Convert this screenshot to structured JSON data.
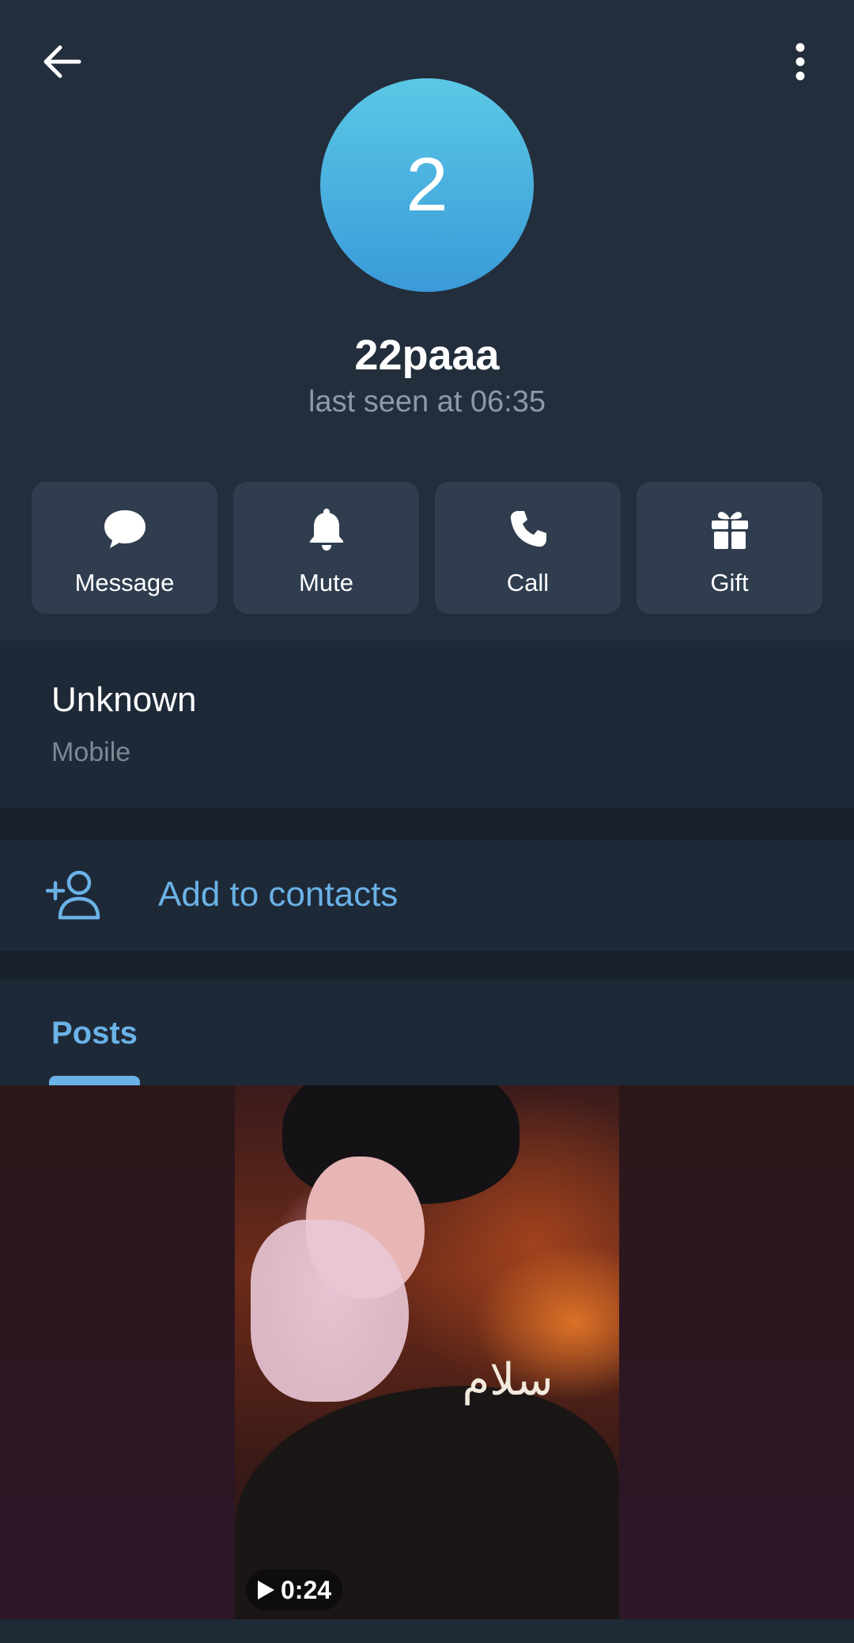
{
  "header": {
    "avatar_letter": "2",
    "name": "22paaa",
    "status": "last seen at 06:35"
  },
  "actions": [
    {
      "label": "Message",
      "icon": "message-icon"
    },
    {
      "label": "Mute",
      "icon": "bell-icon"
    },
    {
      "label": "Call",
      "icon": "phone-icon"
    },
    {
      "label": "Gift",
      "icon": "gift-icon"
    }
  ],
  "info": {
    "value": "Unknown",
    "label": "Mobile"
  },
  "add_contact": {
    "label": "Add to contacts",
    "icon": "add-contact-icon"
  },
  "tabs": {
    "posts": "Posts"
  },
  "media": {
    "duration": "0:24"
  },
  "colors": {
    "background": "#232e3c",
    "section": "#1e2938",
    "button": "#2f3d4f",
    "accent": "#6ab2e7",
    "secondary_text": "#8e99a6"
  }
}
